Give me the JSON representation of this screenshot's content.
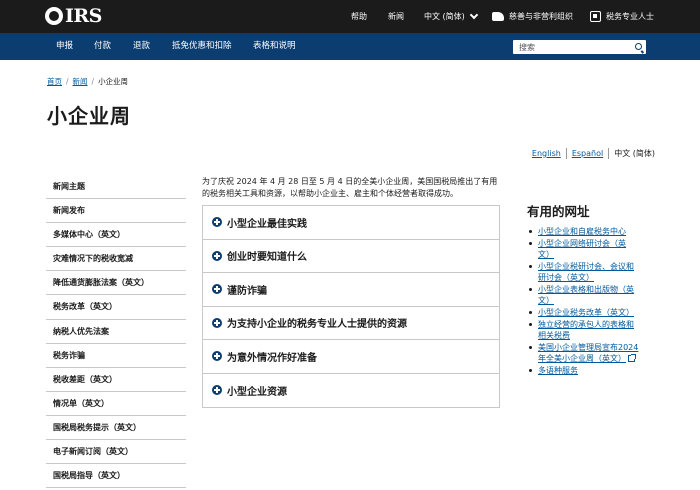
{
  "header": {
    "logo_text": "IRS",
    "help": "帮助",
    "news": "新闻",
    "language": "中文 (简体)",
    "charities": "慈善与非营利组织",
    "tax_pros": "税务专业人士"
  },
  "nav": {
    "items": [
      "申报",
      "付款",
      "退款",
      "抵免优惠和扣除",
      "表格和说明"
    ],
    "search_placeholder": "搜索"
  },
  "breadcrumb": {
    "home": "首页",
    "newsroom": "新闻",
    "current": "小企业周"
  },
  "page_title": "小企业周",
  "lang_switch": {
    "english": "English",
    "spanish": "Español",
    "chinese": "中文 (简体)"
  },
  "sidebar": {
    "items": [
      "新闻主题",
      "新闻发布",
      "多媒体中心（英文）",
      "灾难情况下的税收宽减",
      "降低通货膨胀法案（英文）",
      "税务改革（英文）",
      "纳税人优先法案",
      "税务诈骗",
      "税收差距（英文）",
      "情况单（英文）",
      "国税局税务提示（英文）",
      "电子新闻订阅（英文）",
      "国税局指导（英文）"
    ]
  },
  "intro": {
    "line1": "为了庆祝 2024 年 4 月 28 日至 5 月 4 日的全美小企业周，美国国税局推出了有用",
    "line2": "的税务相关工具和资源，以帮助小企业主、雇主和个体经营者取得成功。"
  },
  "accordion": {
    "items": [
      "小型企业最佳实践",
      "创业时要知道什么",
      "谨防诈骗",
      "为支持小企业的税务专业人士提供的资源",
      "为意外情况作好准备",
      "小型企业资源"
    ]
  },
  "useful_links": {
    "heading": "有用的网址",
    "items": [
      {
        "lines": [
          "小型企业和自雇税务中心"
        ]
      },
      {
        "lines": [
          "小型企业网络研讨会（英",
          "文）"
        ]
      },
      {
        "lines": [
          "小型企业税研讨会、会议和",
          "研讨会（英文）"
        ]
      },
      {
        "lines": [
          "小型企业表格和出版物（英",
          "文）"
        ]
      },
      {
        "lines": [
          "小型企业税务改革（英文）"
        ]
      },
      {
        "lines": [
          "独立经营的承包人的表格和",
          "相关税费"
        ]
      },
      {
        "lines": [
          "美国小企业管理局宣布2024",
          "年全美小企业周（英文）"
        ],
        "external": true
      },
      {
        "lines": [
          "多语种服务"
        ]
      }
    ]
  },
  "colors": {
    "topbar": "#1b1b1b",
    "navbar": "#0b3d70",
    "link": "#00599c"
  }
}
